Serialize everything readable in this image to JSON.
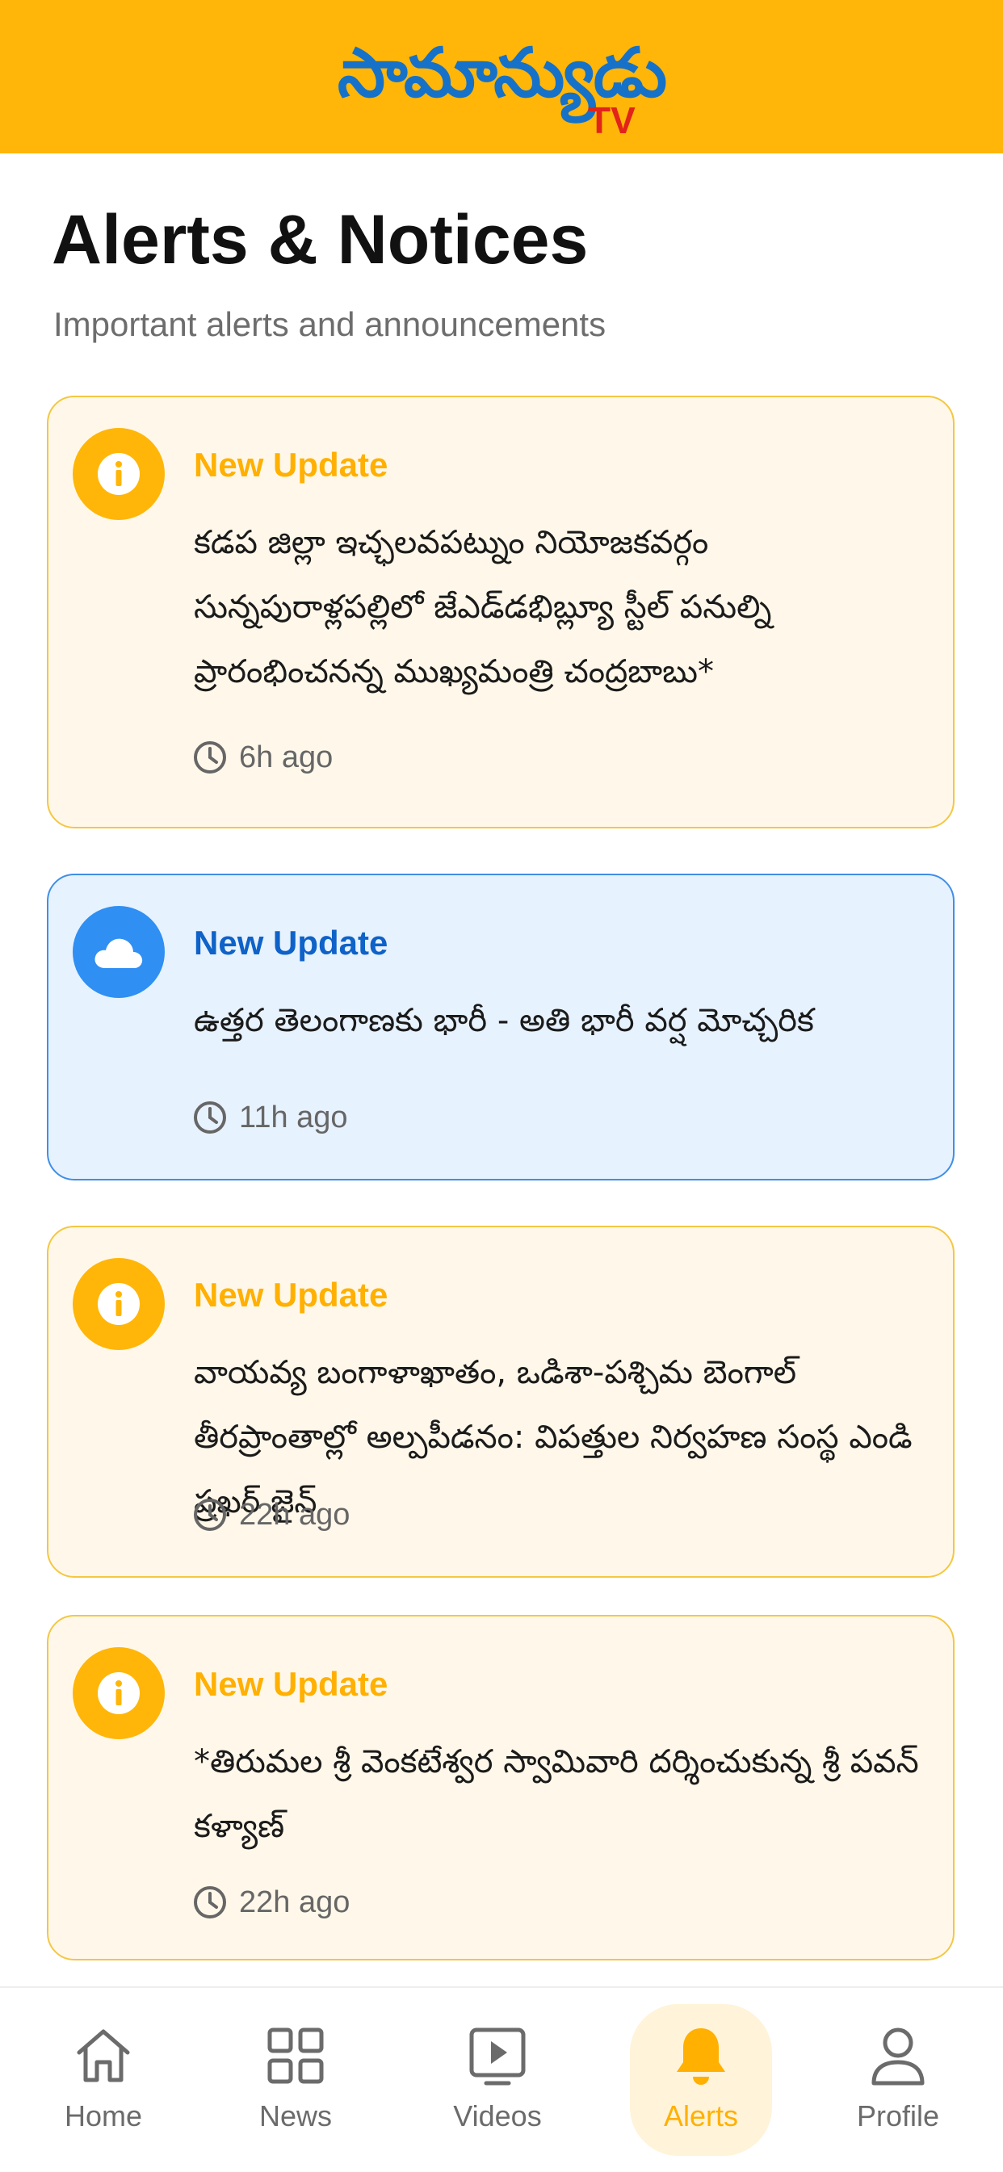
{
  "header": {
    "logo_text": "సామాన్యుడు",
    "logo_suffix": "TV",
    "colors": {
      "background": "#FFB608",
      "logo": "#1671C9",
      "logo_suffix": "#E2231A"
    }
  },
  "page": {
    "title": "Alerts & Notices",
    "subtitle": "Important alerts and announcements"
  },
  "alerts": [
    {
      "icon": "info-icon",
      "label": "New Update",
      "text": "కడప జిల్లా ఇచ్ఛలవపట్నుం నియోజకవర్గం సున్నపురాళ్లపల్లిలో జేఎడ్‌డభిబ్ల్యూ స్టీల్ పనుల్ని ప్రారంభించనన్న ముఖ్యమంత్రి చంద్రబాబు*",
      "time": "6h ago"
    },
    {
      "icon": "cloud-icon",
      "label": "New Update",
      "text": "ఉత్తర తెలంగాణకు భారీ - అతి భారీ వర్ష మోచ్చరిక",
      "time": "11h ago"
    },
    {
      "icon": "info-icon",
      "label": "New Update",
      "text": "వాయవ్య బంగాళాఖాతం, ఒడిశా-పశ్చిమ బెంగాల్ తీరప్రాంతాల్లో అల్పపీడనం: విపత్తుల నిర్వహణ సంస్థ ఎండి ప్రఖర్ జైన్",
      "time": "22h ago"
    },
    {
      "icon": "info-icon",
      "label": "New Update",
      "text": "*తిరుమల శ్రీ వెంకటేశ్వర స్వామివారి దర్శించుకున్న శ్రీ పవన్ కళ్యాణ్",
      "time": "22h ago"
    }
  ],
  "nav": {
    "items": [
      {
        "label": "Home",
        "icon": "home-icon"
      },
      {
        "label": "News",
        "icon": "grid-icon"
      },
      {
        "label": "Videos",
        "icon": "video-icon"
      },
      {
        "label": "Alerts",
        "icon": "bell-icon",
        "active": true
      },
      {
        "label": "Profile",
        "icon": "user-icon"
      }
    ],
    "colors": {
      "active": "#FFB000",
      "inactive": "#6b6b6b"
    }
  }
}
